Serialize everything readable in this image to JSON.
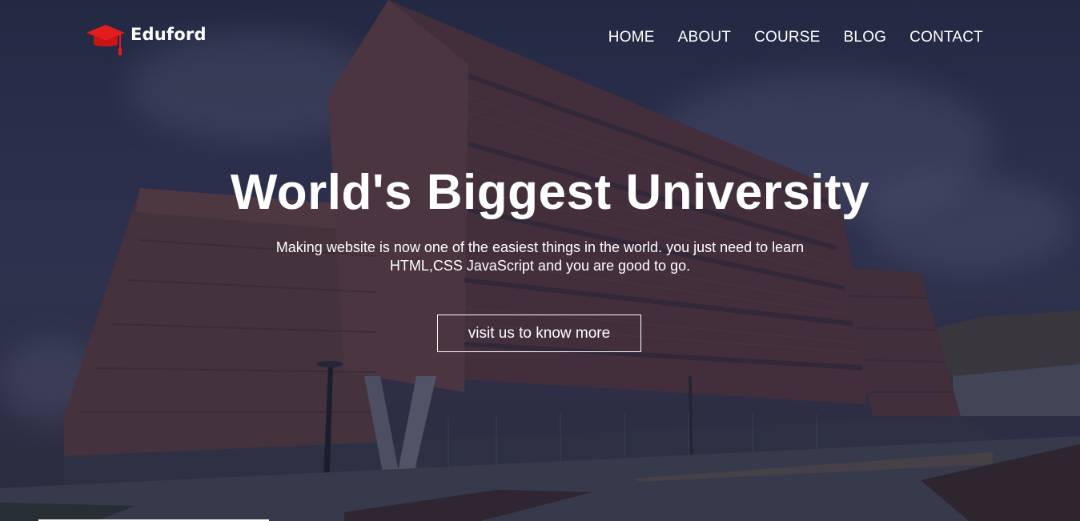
{
  "brand": {
    "name": "Eduford",
    "accent": "#e11d1d"
  },
  "nav": {
    "items": [
      {
        "label": "HOME"
      },
      {
        "label": "ABOUT"
      },
      {
        "label": "COURSE"
      },
      {
        "label": "BLOG"
      },
      {
        "label": "CONTACT"
      }
    ]
  },
  "hero": {
    "title": "World's Biggest University",
    "subtitle_line1": "Making website is now one of the easiest things in the world. you just need to learn",
    "subtitle_line2": "HTML,CSS JavaScript and you are good to go.",
    "cta_label": "visit us to know more",
    "background_icon": "university-building-photo",
    "overlay_color": "#1e2548"
  }
}
